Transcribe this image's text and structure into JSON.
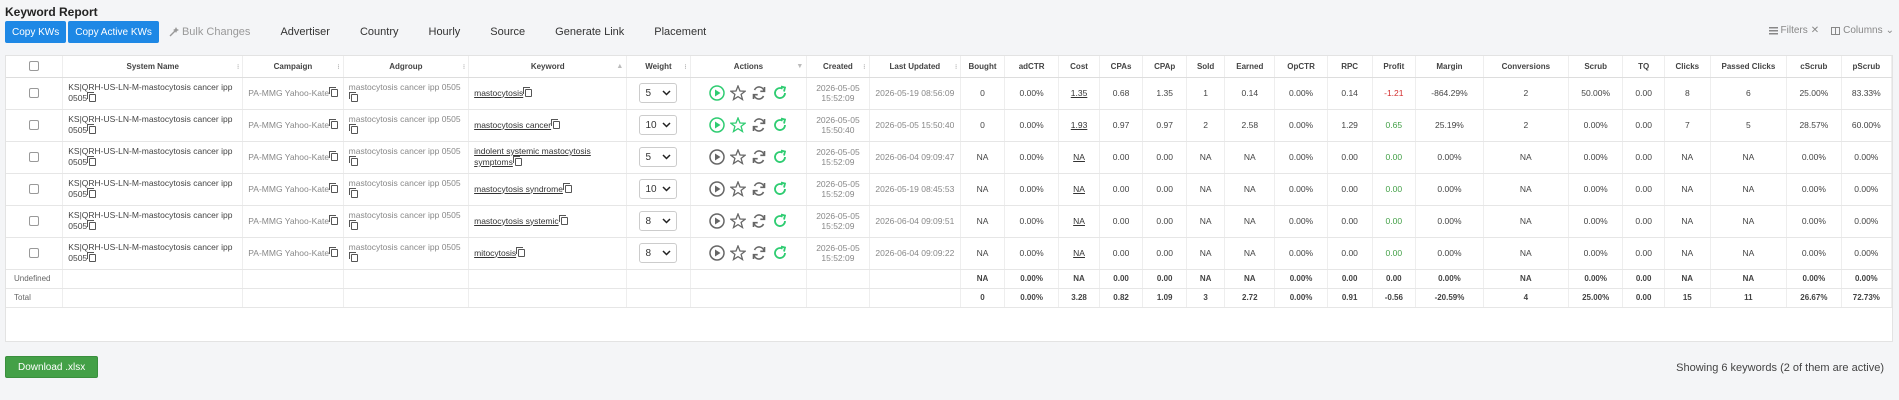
{
  "title": "Keyword Report",
  "toolbar": {
    "copy_kws": "Copy KWs",
    "copy_active_kws": "Copy Active KWs",
    "bulk_changes": "Bulk Changes",
    "tabs": [
      "Advertiser",
      "Country",
      "Hourly",
      "Source",
      "Generate Link",
      "Placement"
    ],
    "filters": "Filters",
    "columns": "Columns"
  },
  "table": {
    "headers": [
      "",
      "System Name",
      "Campaign",
      "Adgroup",
      "Keyword",
      "Weight",
      "Actions",
      "Created",
      "Last Updated",
      "Bought",
      "adCTR",
      "Cost",
      "CPAs",
      "CPAp",
      "Sold",
      "Earned",
      "OpCTR",
      "RPC",
      "Profit",
      "Margin",
      "Conversions",
      "Scrub",
      "TQ",
      "Clicks",
      "Passed Clicks",
      "cScrub",
      "pScrub"
    ],
    "rows": [
      {
        "system": "KS|QRH-US-LN-M-mastocytosis cancer ipp 0505",
        "campaign": "PA-MMG Yahoo-Kate",
        "adgroup": "mastocytosis cancer ipp 0505",
        "keyword": "mastocytosis",
        "weight": "5",
        "starred": false,
        "created": "2026-05-05 15:52:09",
        "updated": "2026-05-19 08:56:09",
        "bought": "0",
        "adctr": "0.00%",
        "cost": "1.35",
        "cpas": "0.68",
        "cpap": "1.35",
        "sold": "1",
        "earned": "0.14",
        "opctr": "0.00%",
        "rpc": "0.14",
        "profit": "-1.21",
        "profit_class": "neg",
        "margin": "-864.29%",
        "conversions": "2",
        "scrub": "50.00%",
        "tq": "0.00",
        "clicks": "8",
        "passed": "6",
        "cscrub": "25.00%",
        "pscrub": "83.33%"
      },
      {
        "system": "KS|QRH-US-LN-M-mastocytosis cancer ipp 0505",
        "campaign": "PA-MMG Yahoo-Kate",
        "adgroup": "mastocytosis cancer ipp 0505",
        "keyword": "mastocytosis cancer",
        "weight": "10",
        "starred": true,
        "created": "2026-05-05 15:50:40",
        "updated": "2026-05-05 15:50:40",
        "bought": "0",
        "adctr": "0.00%",
        "cost": "1.93",
        "cpas": "0.97",
        "cpap": "0.97",
        "sold": "2",
        "earned": "2.58",
        "opctr": "0.00%",
        "rpc": "1.29",
        "profit": "0.65",
        "profit_class": "pos",
        "margin": "25.19%",
        "conversions": "2",
        "scrub": "0.00%",
        "tq": "0.00",
        "clicks": "7",
        "passed": "5",
        "cscrub": "28.57%",
        "pscrub": "60.00%"
      },
      {
        "system": "KS|QRH-US-LN-M-mastocytosis cancer ipp 0505",
        "campaign": "PA-MMG Yahoo-Kate",
        "adgroup": "mastocytosis cancer ipp 0505",
        "keyword": "indolent systemic mastocytosis symptoms",
        "weight": "5",
        "starred": false,
        "created": "2026-05-05 15:52:09",
        "updated": "2026-06-04 09:09:47",
        "bought": "NA",
        "adctr": "0.00%",
        "cost": "NA",
        "cpas": "0.00",
        "cpap": "0.00",
        "sold": "NA",
        "earned": "NA",
        "opctr": "0.00%",
        "rpc": "0.00",
        "profit": "0.00",
        "profit_class": "pos",
        "margin": "0.00%",
        "conversions": "NA",
        "scrub": "0.00%",
        "tq": "0.00",
        "clicks": "NA",
        "passed": "NA",
        "cscrub": "0.00%",
        "pscrub": "0.00%"
      },
      {
        "system": "KS|QRH-US-LN-M-mastocytosis cancer ipp 0505",
        "campaign": "PA-MMG Yahoo-Kate",
        "adgroup": "mastocytosis cancer ipp 0505",
        "keyword": "mastocytosis syndrome",
        "weight": "10",
        "starred": false,
        "created": "2026-05-05 15:52:09",
        "updated": "2026-05-19 08:45:53",
        "bought": "NA",
        "adctr": "0.00%",
        "cost": "NA",
        "cpas": "0.00",
        "cpap": "0.00",
        "sold": "NA",
        "earned": "NA",
        "opctr": "0.00%",
        "rpc": "0.00",
        "profit": "0.00",
        "profit_class": "pos",
        "margin": "0.00%",
        "conversions": "NA",
        "scrub": "0.00%",
        "tq": "0.00",
        "clicks": "NA",
        "passed": "NA",
        "cscrub": "0.00%",
        "pscrub": "0.00%"
      },
      {
        "system": "KS|QRH-US-LN-M-mastocytosis cancer ipp 0505",
        "campaign": "PA-MMG Yahoo-Kate",
        "adgroup": "mastocytosis cancer ipp 0505",
        "keyword": "mastocytosis systemic",
        "weight": "8",
        "starred": false,
        "created": "2026-05-05 15:52:09",
        "updated": "2026-06-04 09:09:51",
        "bought": "NA",
        "adctr": "0.00%",
        "cost": "NA",
        "cpas": "0.00",
        "cpap": "0.00",
        "sold": "NA",
        "earned": "NA",
        "opctr": "0.00%",
        "rpc": "0.00",
        "profit": "0.00",
        "profit_class": "pos",
        "margin": "0.00%",
        "conversions": "NA",
        "scrub": "0.00%",
        "tq": "0.00",
        "clicks": "NA",
        "passed": "NA",
        "cscrub": "0.00%",
        "pscrub": "0.00%"
      },
      {
        "system": "KS|QRH-US-LN-M-mastocytosis cancer ipp 0505",
        "campaign": "PA-MMG Yahoo-Kate",
        "adgroup": "mastocytosis cancer ipp 0505",
        "keyword": "mitocytosis",
        "weight": "8",
        "starred": false,
        "created": "2026-05-05 15:52:09",
        "updated": "2026-06-04 09:09:22",
        "bought": "NA",
        "adctr": "0.00%",
        "cost": "NA",
        "cpas": "0.00",
        "cpap": "0.00",
        "sold": "NA",
        "earned": "NA",
        "opctr": "0.00%",
        "rpc": "0.00",
        "profit": "0.00",
        "profit_class": "pos",
        "margin": "0.00%",
        "conversions": "NA",
        "scrub": "0.00%",
        "tq": "0.00",
        "clicks": "NA",
        "passed": "NA",
        "cscrub": "0.00%",
        "pscrub": "0.00%"
      }
    ],
    "summary": [
      {
        "label": "Undefined",
        "bought": "NA",
        "adctr": "0.00%",
        "cost": "NA",
        "cpas": "0.00",
        "cpap": "0.00",
        "sold": "NA",
        "earned": "NA",
        "opctr": "0.00%",
        "rpc": "0.00",
        "profit": "0.00",
        "margin": "0.00%",
        "conversions": "NA",
        "scrub": "0.00%",
        "tq": "0.00",
        "clicks": "NA",
        "passed": "NA",
        "cscrub": "0.00%",
        "pscrub": "0.00%"
      },
      {
        "label": "Total",
        "bought": "0",
        "adctr": "0.00%",
        "cost": "3.28",
        "cpas": "0.82",
        "cpap": "1.09",
        "sold": "3",
        "earned": "2.72",
        "opctr": "0.00%",
        "rpc": "0.91",
        "profit": "-0.56",
        "margin": "-20.59%",
        "conversions": "4",
        "scrub": "25.00%",
        "tq": "0.00",
        "clicks": "15",
        "passed": "11",
        "cscrub": "26.67%",
        "pscrub": "72.73%"
      }
    ]
  },
  "footer": {
    "download": "Download .xlsx",
    "showing": "Showing 6 keywords (2 of them are active)"
  },
  "colors": {
    "primary": "#1e88e5",
    "success": "#43a047",
    "danger": "#d32f2f",
    "action_green": "#2ecc71"
  }
}
